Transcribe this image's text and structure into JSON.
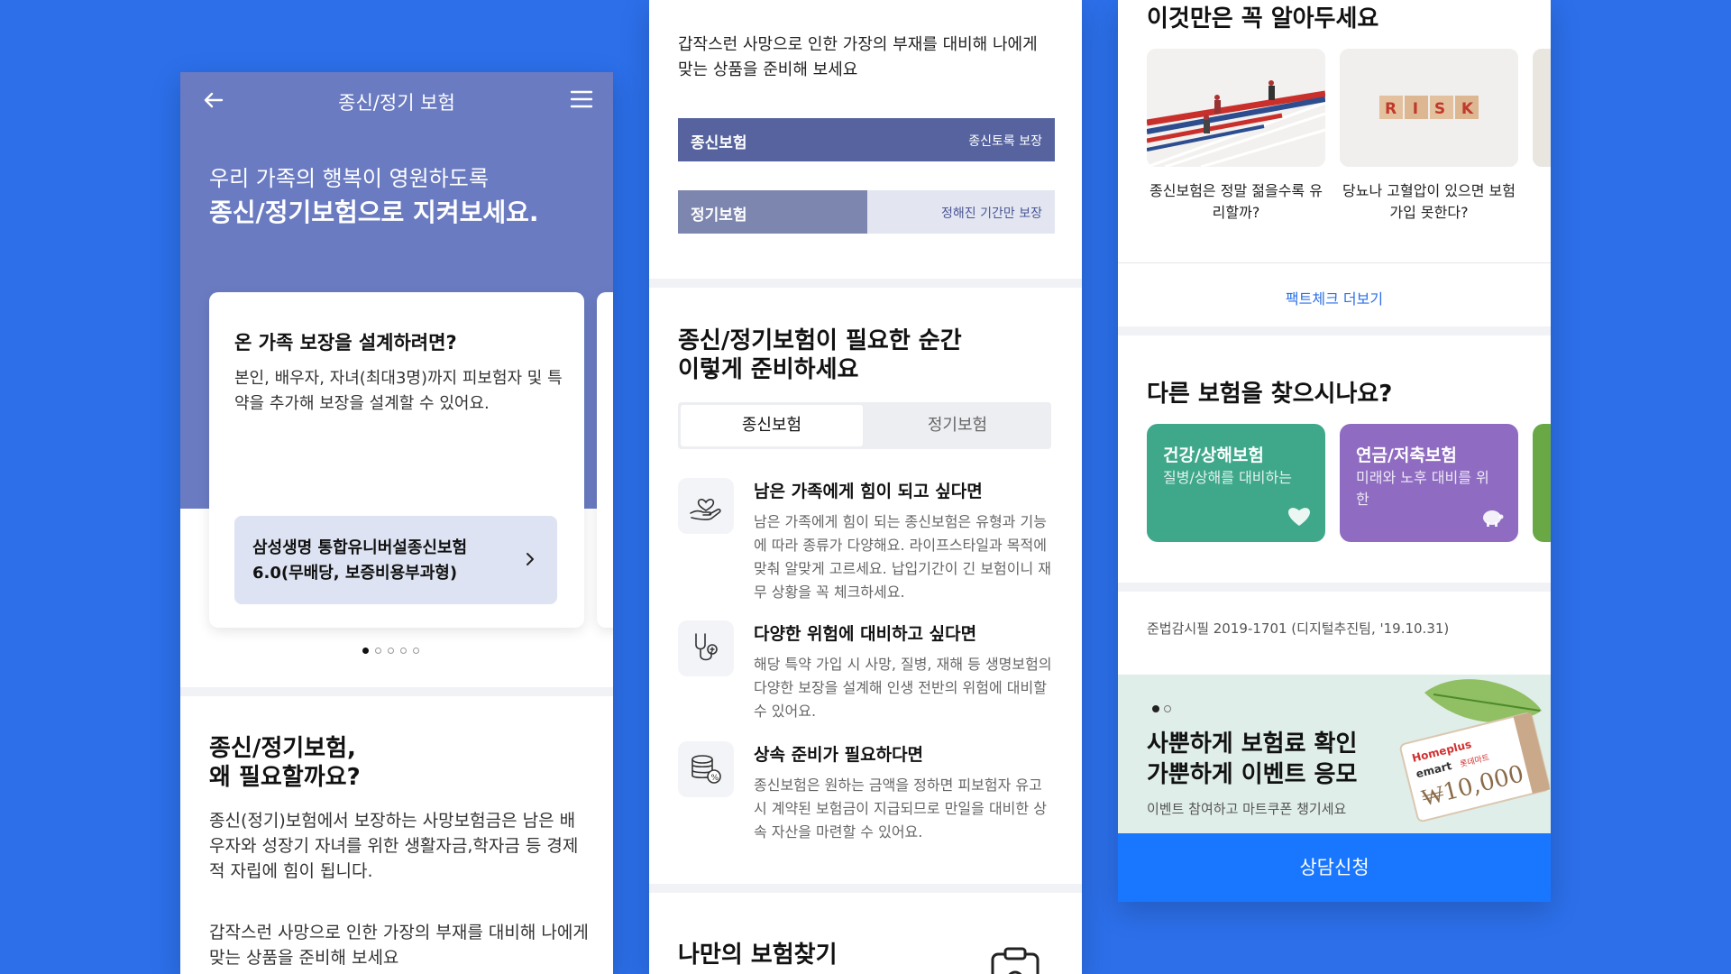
{
  "screen1": {
    "nav_title": "종신/정기 보험",
    "hero_line1": "우리 가족의 행복이 영원하도록",
    "hero_line2": "종신/정기보험으로 지켜보세요.",
    "card": {
      "title": "온 가족 보장을 설계하려면?",
      "desc": "본인, 배우자, 자녀(최대3명)까지 피보험자 및 특약을 추가해 보장을 설계할 수 있어요.",
      "product": "삼성생명 통합유니버설종신보험 6.0(무배당, 보증비용부과형)"
    },
    "section_title_1": "종신/정기보험,",
    "section_title_2": "왜 필요할까요?",
    "section_desc": "종신(정기)보험에서 보장하는 사망보험금은 남은 배우자와 성장기 자녀를 위한 생활자금,학자금 등 경제적 자립에 힘이 됩니다.",
    "section_desc2": "갑작스런 사망으로 인한 가장의 부재를 대비해 나에게 맞는 상품을 준비해 보세요"
  },
  "screen2": {
    "intro": "갑작스런 사망으로 인한 가장의 부재를 대비해 나에게 맞는 상품을 준비해 보세요",
    "bar1_label": "종신보험",
    "bar1_right": "종신토록 보장",
    "bar2_label": "정기보험",
    "bar2_right": "정해진 기간만 보장",
    "section_title_1": "종신/정기보험이 필요한 순간",
    "section_title_2": "이렇게 준비하세요",
    "tabs": [
      "종신보험",
      "정기보험"
    ],
    "items": [
      {
        "title": "남은 가족에게 힘이 되고 싶다면",
        "desc": "남은 가족에게 힘이 되는 종신보험은 유형과 기능에 따라 종류가 다양해요. 라이프스타일과 목적에 맞춰 알맞게 고르세요. 납입기간이 긴 보험이니 재무 상황을 꼭 체크하세요.",
        "icon": "heart-hand-icon"
      },
      {
        "title": "다양한 위험에 대비하고 싶다면",
        "desc": "해당 특약 가입 시 사망, 질병, 재해 등 생명보험의 다양한 보장을 설계해 인생 전반의 위험에 대비할 수 있어요.",
        "icon": "stethoscope-icon"
      },
      {
        "title": "상속 준비가 필요하다면",
        "desc": "종신보험은 원하는 금액을 정하면 피보험자 유고 시 계약된 보험금이 지급되므로 만일을 대비한 상속 자산을 마련할 수 있어요.",
        "icon": "coins-icon"
      }
    ],
    "section3_title": "나만의 보험찾기"
  },
  "screen3": {
    "section_title": "이것만은 꼭 알아두세요",
    "facts": [
      {
        "caption": "종신보험은 정말 젊을수록 유리할까?"
      },
      {
        "caption": "당뇨나 고혈압이 있으면 보험 가입 못한다?",
        "image_text": "RISK"
      }
    ],
    "more_link": "팩트체크 더보기",
    "other_title": "다른 보험을 찾으시나요?",
    "tiles": [
      {
        "title": "건강/상해보험",
        "desc": "질병/상해를 대비하는",
        "color": "#3fa88a",
        "icon": "heart-icon"
      },
      {
        "title": "연금/저축보험",
        "desc": "미래와 노후 대비를 위한",
        "color": "#8f6cc2",
        "icon": "piggy-bank-icon"
      }
    ],
    "tile3_color": "#6aa845",
    "law_text": "준법감시필 2019-1701 (디지털추진팀, '19.10.31)",
    "banner": {
      "title_1": "사뿐하게 보험료 확인",
      "title_2": "가뿐하게 이벤트 응모",
      "sub": "이벤트 참여하고 마트쿠폰 챙기세요",
      "coupon_brand1": "Homeplus",
      "coupon_brand2": "emart",
      "coupon_brand3": "롯데마트",
      "coupon_amount": "₩10,000"
    },
    "cta": "상담신청"
  },
  "colors": {
    "background": "#2c6fe9",
    "hero": "#6a7bc2",
    "bar_dark": "#56639e",
    "cta": "#1976ff"
  }
}
